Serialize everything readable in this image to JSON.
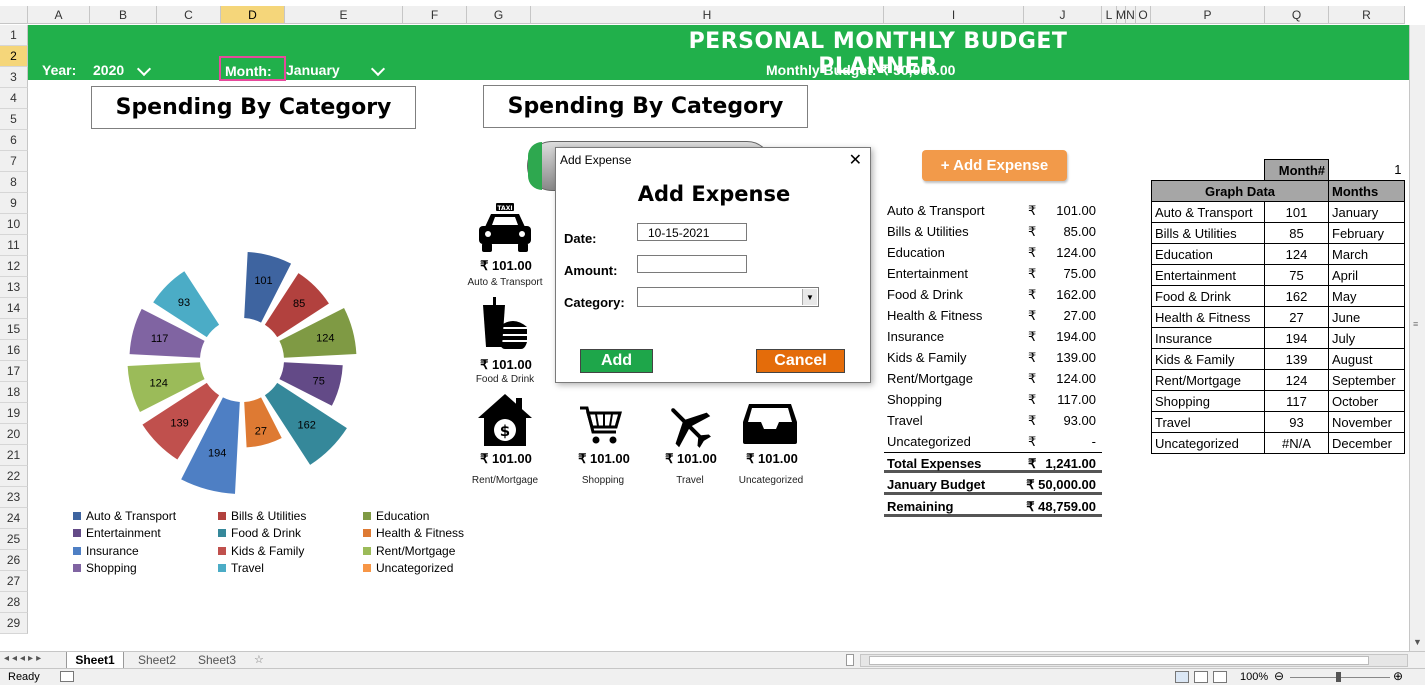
{
  "columns": [
    "A",
    "B",
    "C",
    "D",
    "E",
    "F",
    "G",
    "H",
    "I",
    "J",
    "L",
    "M",
    "N",
    "O",
    "P",
    "Q",
    "R"
  ],
  "rows": [
    "1",
    "2",
    "3",
    "4",
    "5",
    "6",
    "7",
    "8",
    "9",
    "10",
    "11",
    "12",
    "13",
    "14",
    "15",
    "16",
    "17",
    "18",
    "19",
    "20",
    "21",
    "22",
    "23",
    "24",
    "25",
    "26",
    "27",
    "28",
    "29"
  ],
  "banner": {
    "title": "PERSONAL MONTHLY BUDGET PLANNER",
    "year_label": "Year:",
    "year_value": "2020",
    "month_label": "Month:",
    "month_value": "January",
    "budget_text": "Monthly Budget: ₹ 50,000.00"
  },
  "chart_box_title": "Spending By Category",
  "icons_box_title": "Spending By Category",
  "chart_data": {
    "type": "pie",
    "title": "",
    "categories": [
      "Auto & Transport",
      "Bills & Utilities",
      "Education",
      "Entertainment",
      "Food & Drink",
      "Health & Fitness",
      "Insurance",
      "Kids & Family",
      "Rent/Mortgage",
      "Shopping",
      "Travel",
      "Uncategorized"
    ],
    "values": [
      101,
      85,
      124,
      75,
      162,
      27,
      194,
      139,
      124,
      117,
      93,
      0
    ],
    "colors": [
      "#3e64a0",
      "#b2413e",
      "#7f9a44",
      "#634a87",
      "#35889a",
      "#de7a33",
      "#4e7fc4",
      "#c0504d",
      "#9bbb59",
      "#8064a2",
      "#4bacc6",
      "#f79646"
    ],
    "legend_position": "bottom"
  },
  "legend": [
    {
      "label": "Auto & Transport",
      "color": "#3e64a0"
    },
    {
      "label": "Bills & Utilities",
      "color": "#b2413e"
    },
    {
      "label": "Education",
      "color": "#7f9a44"
    },
    {
      "label": "Entertainment",
      "color": "#634a87"
    },
    {
      "label": "Food & Drink",
      "color": "#35889a"
    },
    {
      "label": "Health & Fitness",
      "color": "#de7a33"
    },
    {
      "label": "Insurance",
      "color": "#4e7fc4"
    },
    {
      "label": "Kids & Family",
      "color": "#c0504d"
    },
    {
      "label": "Rent/Mortgage",
      "color": "#9bbb59"
    },
    {
      "label": "Shopping",
      "color": "#8064a2"
    },
    {
      "label": "Travel",
      "color": "#4bacc6"
    },
    {
      "label": "Uncategorized",
      "color": "#f79646"
    }
  ],
  "icon_tiles": [
    {
      "icon": "taxi-icon",
      "value": "₹ 101.00",
      "label": "Auto & Transport"
    },
    {
      "icon": "food-drink-icon",
      "value": "₹ 101.00",
      "label": "Food & Drink"
    },
    {
      "icon": "house-money-icon",
      "value": "₹ 101.00",
      "label": "Rent/Mortgage"
    },
    {
      "icon": "shopping-cart-icon",
      "value": "₹ 101.00",
      "label": "Shopping"
    },
    {
      "icon": "airplane-icon",
      "value": "₹ 101.00",
      "label": "Travel"
    },
    {
      "icon": "inbox-tray-icon",
      "value": "₹ 101.00",
      "label": "Uncategorized"
    }
  ],
  "add_expense_button": "+ Add Expense",
  "expenses": [
    {
      "category": "Auto & Transport",
      "cur": "₹",
      "amount": "101.00"
    },
    {
      "category": "Bills & Utilities",
      "cur": "₹",
      "amount": "85.00"
    },
    {
      "category": "Education",
      "cur": "₹",
      "amount": "124.00"
    },
    {
      "category": "Entertainment",
      "cur": "₹",
      "amount": "75.00"
    },
    {
      "category": "Food & Drink",
      "cur": "₹",
      "amount": "162.00"
    },
    {
      "category": "Health & Fitness",
      "cur": "₹",
      "amount": "27.00"
    },
    {
      "category": "Insurance",
      "cur": "₹",
      "amount": "194.00"
    },
    {
      "category": "Kids & Family",
      "cur": "₹",
      "amount": "139.00"
    },
    {
      "category": "Rent/Mortgage",
      "cur": "₹",
      "amount": "124.00"
    },
    {
      "category": "Shopping",
      "cur": "₹",
      "amount": "117.00"
    },
    {
      "category": "Travel",
      "cur": "₹",
      "amount": "93.00"
    },
    {
      "category": "Uncategorized",
      "cur": "₹",
      "amount": "-"
    }
  ],
  "totals": [
    {
      "label": "Total Expenses",
      "cur": "₹",
      "amount": "1,241.00"
    },
    {
      "label": "January Budget",
      "cur": "",
      "amount": "₹ 50,000.00"
    },
    {
      "label": "Remaining",
      "cur": "",
      "amount": "₹ 48,759.00"
    }
  ],
  "graph_table": {
    "month_label": "Month#",
    "month_value": "1",
    "header_data": "Graph Data",
    "header_months": "Months",
    "rows": [
      {
        "cat": "Auto & Transport",
        "val": "101",
        "month": "January"
      },
      {
        "cat": "Bills & Utilities",
        "val": "85",
        "month": "February"
      },
      {
        "cat": "Education",
        "val": "124",
        "month": "March"
      },
      {
        "cat": "Entertainment",
        "val": "75",
        "month": "April"
      },
      {
        "cat": "Food & Drink",
        "val": "162",
        "month": "May"
      },
      {
        "cat": "Health & Fitness",
        "val": "27",
        "month": "June"
      },
      {
        "cat": "Insurance",
        "val": "194",
        "month": "July"
      },
      {
        "cat": "Kids & Family",
        "val": "139",
        "month": "August"
      },
      {
        "cat": "Rent/Mortgage",
        "val": "124",
        "month": "September"
      },
      {
        "cat": "Shopping",
        "val": "117",
        "month": "October"
      },
      {
        "cat": "Travel",
        "val": "93",
        "month": "November"
      },
      {
        "cat": "Uncategorized",
        "val": "#N/A",
        "month": "December"
      }
    ]
  },
  "dialog": {
    "window_title": "Add Expense",
    "heading": "Add Expense",
    "date_label": "Date:",
    "date_value": "10-15-2021",
    "amount_label": "Amount:",
    "amount_value": "",
    "category_label": "Category:",
    "category_value": "",
    "add_button": "Add",
    "cancel_button": "Cancel",
    "add_color": "#1ea64a",
    "cancel_color": "#e46c0a"
  },
  "sheet_tabs": [
    "Sheet1",
    "Sheet2",
    "Sheet3"
  ],
  "status": {
    "ready": "Ready",
    "zoom": "100%"
  }
}
